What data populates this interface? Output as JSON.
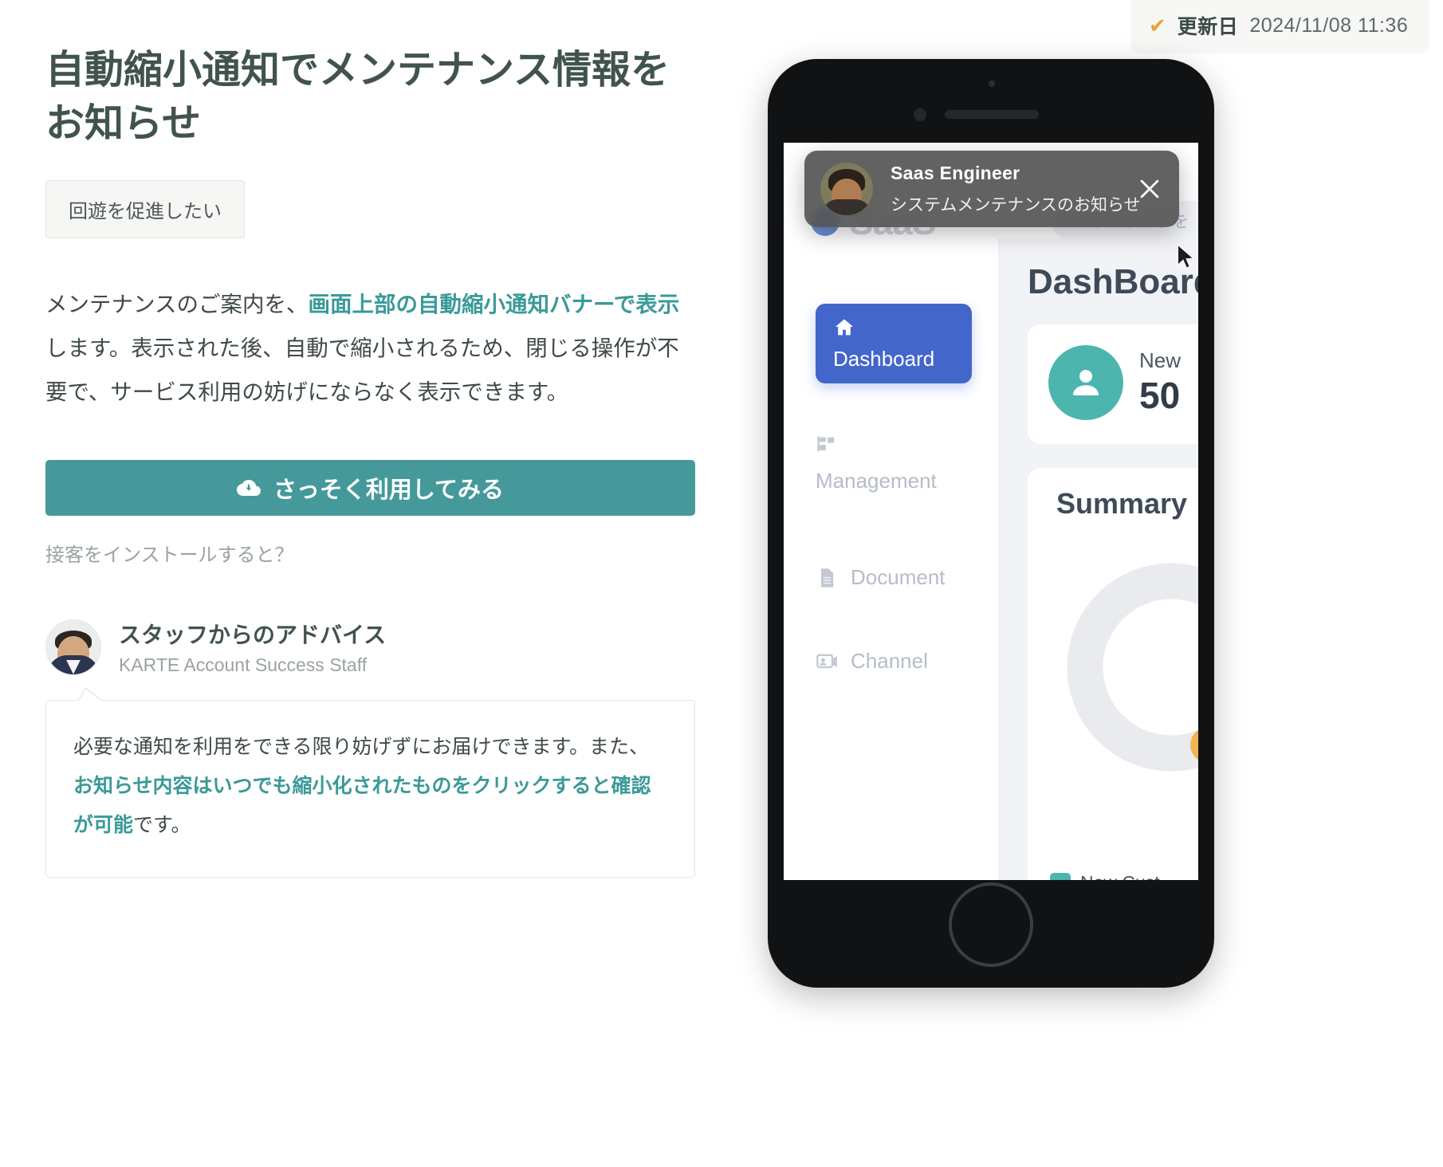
{
  "updated": {
    "check_icon": "check-icon",
    "label": "更新日",
    "value": "2024/11/08  11:36"
  },
  "content": {
    "title": "自動縮小通知でメンテナンス情報をお知らせ",
    "tag": "回遊を促進したい",
    "lead_part1": "メンテナンスのご案内を、",
    "lead_highlight": "画面上部の自動縮小通知バナーで表示",
    "lead_part2": "します。表示された後、自動で縮小されるため、閉じる操作が不要で、サービス利用の妨げにならなく表示できます。",
    "cta_label": "さっそく利用してみる",
    "cta_icon": "cloud-download-icon",
    "subnote": "接客をインストールすると？"
  },
  "staff": {
    "avatar_icon": "staff-avatar",
    "name": "スタッフからのアドバイス",
    "role": "KARTE Account Success Staff",
    "advice_part1": "必要な通知を利用をできる限り妨げずにお届けできます。また、",
    "advice_highlight": "お知らせ内容はいつでも縮小化されたものをクリックすると確認が可能",
    "advice_part2": "です。"
  },
  "phone": {
    "notification": {
      "avatar_icon": "notification-avatar",
      "title": "Saas Engineer",
      "message": "システムメンテナンスのお知らせ",
      "close_icon": "close-icon"
    },
    "app": {
      "logo": "SaaS",
      "logo_mark_icon": "saas-logo-mark",
      "search_placeholder": "キーワードを",
      "search_icon": "search-icon",
      "nav": [
        {
          "label": "Dashboard",
          "icon": "home-icon",
          "active": true
        },
        {
          "label": "Management",
          "icon": "sitemap-icon",
          "active": false
        },
        {
          "label": "Document",
          "icon": "document-icon",
          "active": false
        },
        {
          "label": "Channel",
          "icon": "channel-icon",
          "active": false
        }
      ],
      "main": {
        "title": "DashBoard",
        "new_card": {
          "icon": "person-icon",
          "label": "New",
          "value": "50"
        },
        "summary_card": {
          "title": "Summary",
          "legend_label": "New Cust",
          "legend_color": "#4cb5ae"
        }
      }
    },
    "cursor_icon": "mouse-cursor-icon"
  },
  "colors": {
    "accent": "#45999a",
    "link": "#3a9a98",
    "title": "#41534d",
    "badge_check": "#e8a33d",
    "app_primary": "#4366cb",
    "app_teal": "#4cb5ae"
  }
}
